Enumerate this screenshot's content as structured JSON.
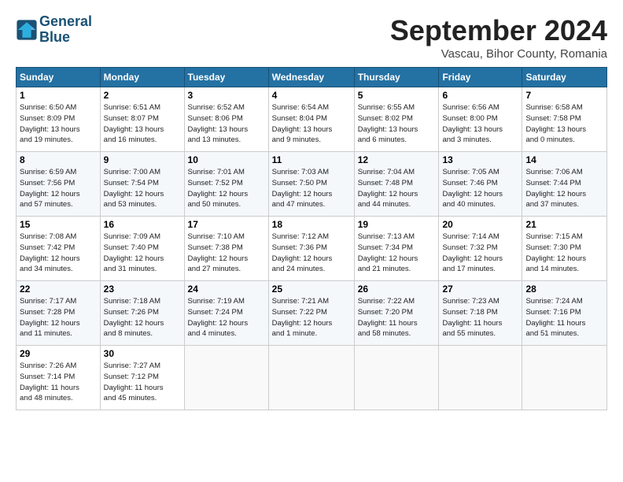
{
  "header": {
    "logo_line1": "General",
    "logo_line2": "Blue",
    "month_title": "September 2024",
    "subtitle": "Vascau, Bihor County, Romania"
  },
  "weekdays": [
    "Sunday",
    "Monday",
    "Tuesday",
    "Wednesday",
    "Thursday",
    "Friday",
    "Saturday"
  ],
  "weeks": [
    [
      {
        "day": "1",
        "info": "Sunrise: 6:50 AM\nSunset: 8:09 PM\nDaylight: 13 hours\nand 19 minutes."
      },
      {
        "day": "2",
        "info": "Sunrise: 6:51 AM\nSunset: 8:07 PM\nDaylight: 13 hours\nand 16 minutes."
      },
      {
        "day": "3",
        "info": "Sunrise: 6:52 AM\nSunset: 8:06 PM\nDaylight: 13 hours\nand 13 minutes."
      },
      {
        "day": "4",
        "info": "Sunrise: 6:54 AM\nSunset: 8:04 PM\nDaylight: 13 hours\nand 9 minutes."
      },
      {
        "day": "5",
        "info": "Sunrise: 6:55 AM\nSunset: 8:02 PM\nDaylight: 13 hours\nand 6 minutes."
      },
      {
        "day": "6",
        "info": "Sunrise: 6:56 AM\nSunset: 8:00 PM\nDaylight: 13 hours\nand 3 minutes."
      },
      {
        "day": "7",
        "info": "Sunrise: 6:58 AM\nSunset: 7:58 PM\nDaylight: 13 hours\nand 0 minutes."
      }
    ],
    [
      {
        "day": "8",
        "info": "Sunrise: 6:59 AM\nSunset: 7:56 PM\nDaylight: 12 hours\nand 57 minutes."
      },
      {
        "day": "9",
        "info": "Sunrise: 7:00 AM\nSunset: 7:54 PM\nDaylight: 12 hours\nand 53 minutes."
      },
      {
        "day": "10",
        "info": "Sunrise: 7:01 AM\nSunset: 7:52 PM\nDaylight: 12 hours\nand 50 minutes."
      },
      {
        "day": "11",
        "info": "Sunrise: 7:03 AM\nSunset: 7:50 PM\nDaylight: 12 hours\nand 47 minutes."
      },
      {
        "day": "12",
        "info": "Sunrise: 7:04 AM\nSunset: 7:48 PM\nDaylight: 12 hours\nand 44 minutes."
      },
      {
        "day": "13",
        "info": "Sunrise: 7:05 AM\nSunset: 7:46 PM\nDaylight: 12 hours\nand 40 minutes."
      },
      {
        "day": "14",
        "info": "Sunrise: 7:06 AM\nSunset: 7:44 PM\nDaylight: 12 hours\nand 37 minutes."
      }
    ],
    [
      {
        "day": "15",
        "info": "Sunrise: 7:08 AM\nSunset: 7:42 PM\nDaylight: 12 hours\nand 34 minutes."
      },
      {
        "day": "16",
        "info": "Sunrise: 7:09 AM\nSunset: 7:40 PM\nDaylight: 12 hours\nand 31 minutes."
      },
      {
        "day": "17",
        "info": "Sunrise: 7:10 AM\nSunset: 7:38 PM\nDaylight: 12 hours\nand 27 minutes."
      },
      {
        "day": "18",
        "info": "Sunrise: 7:12 AM\nSunset: 7:36 PM\nDaylight: 12 hours\nand 24 minutes."
      },
      {
        "day": "19",
        "info": "Sunrise: 7:13 AM\nSunset: 7:34 PM\nDaylight: 12 hours\nand 21 minutes."
      },
      {
        "day": "20",
        "info": "Sunrise: 7:14 AM\nSunset: 7:32 PM\nDaylight: 12 hours\nand 17 minutes."
      },
      {
        "day": "21",
        "info": "Sunrise: 7:15 AM\nSunset: 7:30 PM\nDaylight: 12 hours\nand 14 minutes."
      }
    ],
    [
      {
        "day": "22",
        "info": "Sunrise: 7:17 AM\nSunset: 7:28 PM\nDaylight: 12 hours\nand 11 minutes."
      },
      {
        "day": "23",
        "info": "Sunrise: 7:18 AM\nSunset: 7:26 PM\nDaylight: 12 hours\nand 8 minutes."
      },
      {
        "day": "24",
        "info": "Sunrise: 7:19 AM\nSunset: 7:24 PM\nDaylight: 12 hours\nand 4 minutes."
      },
      {
        "day": "25",
        "info": "Sunrise: 7:21 AM\nSunset: 7:22 PM\nDaylight: 12 hours\nand 1 minute."
      },
      {
        "day": "26",
        "info": "Sunrise: 7:22 AM\nSunset: 7:20 PM\nDaylight: 11 hours\nand 58 minutes."
      },
      {
        "day": "27",
        "info": "Sunrise: 7:23 AM\nSunset: 7:18 PM\nDaylight: 11 hours\nand 55 minutes."
      },
      {
        "day": "28",
        "info": "Sunrise: 7:24 AM\nSunset: 7:16 PM\nDaylight: 11 hours\nand 51 minutes."
      }
    ],
    [
      {
        "day": "29",
        "info": "Sunrise: 7:26 AM\nSunset: 7:14 PM\nDaylight: 11 hours\nand 48 minutes."
      },
      {
        "day": "30",
        "info": "Sunrise: 7:27 AM\nSunset: 7:12 PM\nDaylight: 11 hours\nand 45 minutes."
      },
      {
        "day": "",
        "info": ""
      },
      {
        "day": "",
        "info": ""
      },
      {
        "day": "",
        "info": ""
      },
      {
        "day": "",
        "info": ""
      },
      {
        "day": "",
        "info": ""
      }
    ]
  ]
}
